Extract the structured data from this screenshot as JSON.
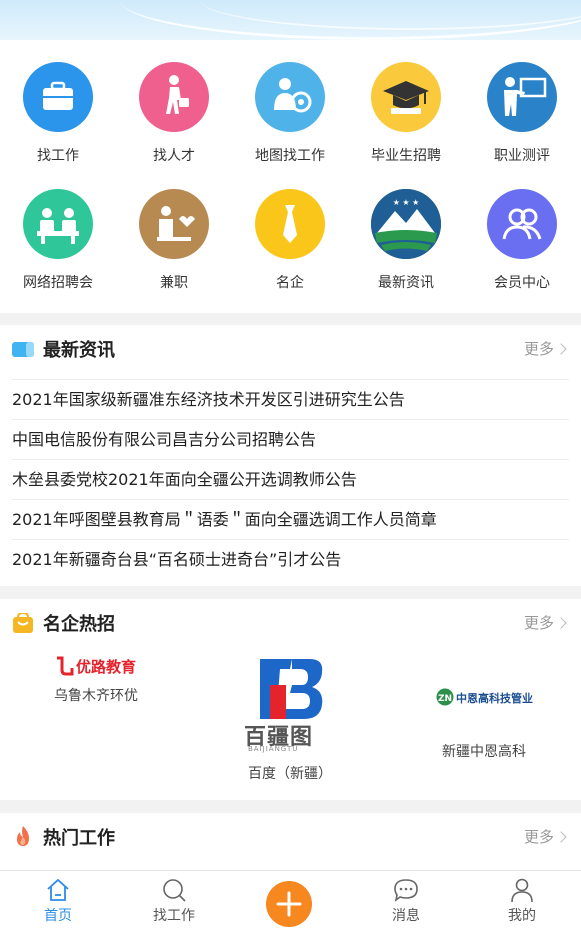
{
  "grid": {
    "items": [
      {
        "label": "找工作",
        "icon": "briefcase-icon",
        "color": "#2a95ea"
      },
      {
        "label": "找人才",
        "icon": "person-walking-icon",
        "color": "#f0608f"
      },
      {
        "label": "地图找工作",
        "icon": "map-person-icon",
        "color": "#4fb3ea"
      },
      {
        "label": "毕业生招聘",
        "icon": "graduation-cap-icon",
        "color": "#fbc93c"
      },
      {
        "label": "职业测评",
        "icon": "teacher-board-icon",
        "color": "#2a83c9"
      },
      {
        "label": "网络招聘会",
        "icon": "meeting-icon",
        "color": "#2fc79a"
      },
      {
        "label": "兼职",
        "icon": "part-time-icon",
        "color": "#b78a52"
      },
      {
        "label": "名企",
        "icon": "tie-icon",
        "color": "#fbc61a"
      },
      {
        "label": "最新资讯",
        "icon": "mountain-emblem-icon",
        "color": "#1f7a43"
      },
      {
        "label": "会员中心",
        "icon": "members-icon",
        "color": "#6a6ef0"
      }
    ]
  },
  "news": {
    "title": "最新资讯",
    "more": "更多",
    "items": [
      "2021年国家级新疆准东经济技术开发区引进研究生公告",
      "中国电信股份有限公司昌吉分公司招聘公告",
      "木垒县委党校2021年面向全疆公开选调教师公告",
      "2021年呼图壁县教育局＂语委＂面向全疆选调工作人员简章",
      "2021年新疆奇台县“百名硕士进奇台”引才公告"
    ]
  },
  "famous": {
    "title": "名企热招",
    "more": "更多",
    "companies": [
      {
        "name": "乌鲁木齐环优",
        "logo_text": "优路教育"
      },
      {
        "name": "百度（新疆）",
        "logo_text": "百疆图",
        "logo_sub": "BAIJIANGTU"
      },
      {
        "name": "新疆中恩高科",
        "logo_text": "中恩高科技管业"
      }
    ]
  },
  "hot": {
    "title": "热门工作",
    "more": "更多"
  },
  "tabbar": {
    "tabs": [
      {
        "label": "首页",
        "icon": "home-icon",
        "active": true
      },
      {
        "label": "找工作",
        "icon": "search-icon",
        "active": false
      },
      {
        "label": "",
        "icon": "plus-icon",
        "active": false
      },
      {
        "label": "消息",
        "icon": "message-icon",
        "active": false
      },
      {
        "label": "我的",
        "icon": "user-icon",
        "active": false
      }
    ]
  },
  "colors": {
    "accent": "#2b8ce8",
    "plus": "#f7871f"
  }
}
